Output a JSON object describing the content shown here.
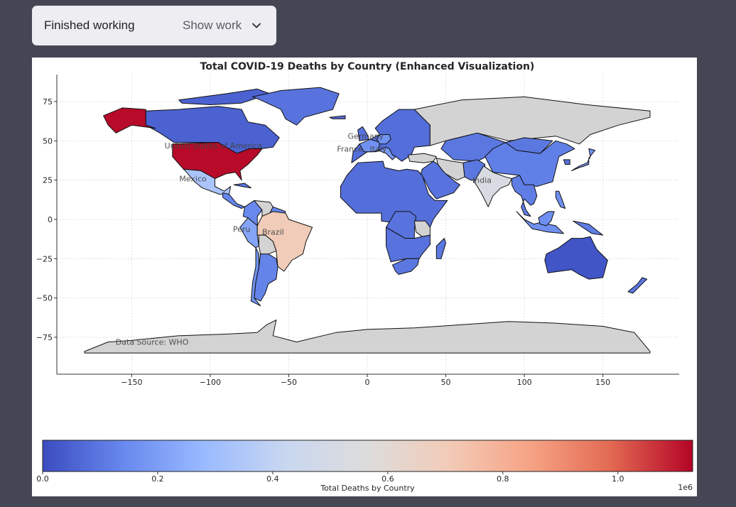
{
  "status": {
    "label": "Finished working",
    "show_work_label": "Show work",
    "chevron_icon": "chevron-down-icon"
  },
  "chart_data": {
    "type": "choropleth",
    "title": "Total COVID-19 Deaths by Country (Enhanced Visualization)",
    "xlabel": "",
    "ylabel": "",
    "xlim": [
      -200,
      196
    ],
    "ylim": [
      -98,
      93
    ],
    "x_ticks": [
      -150,
      -100,
      -50,
      0,
      50,
      100,
      150
    ],
    "x_tick_labels": [
      "−150",
      "−100",
      "−50",
      "0",
      "50",
      "100",
      "150"
    ],
    "y_ticks": [
      75,
      50,
      25,
      0,
      -25,
      -50,
      -75
    ],
    "y_tick_labels": [
      "75",
      "50",
      "25",
      "0",
      "−25",
      "−50",
      "−75"
    ],
    "grid": true,
    "colormap": "coolwarm",
    "missing_color": "#d3d3d3",
    "colorbar": {
      "label": "Total Deaths by Country",
      "range": [
        0,
        1130000
      ],
      "ticks": [
        0,
        0.2,
        0.4,
        0.6,
        0.8,
        1.0
      ],
      "tick_labels": [
        "0.0",
        "0.2",
        "0.4",
        "0.6",
        "0.8",
        "1.0"
      ],
      "offset_label": "1e6",
      "orientation": "horizontal",
      "placement": "bottom",
      "gradient_stops": [
        "#3b4cc0",
        "#6889ee",
        "#9abbff",
        "#c9d7f0",
        "#dddcdc",
        "#f2cbb7",
        "#f6a385",
        "#e26952",
        "#b40426"
      ]
    },
    "annotations": [
      {
        "text": "United States of America",
        "lon": -98,
        "lat": 47
      },
      {
        "text": "Mexico",
        "lon": -111,
        "lat": 26
      },
      {
        "text": "Brazil",
        "lon": -60,
        "lat": -8
      },
      {
        "text": "Peru",
        "lon": -80,
        "lat": -6
      },
      {
        "text": "Germany",
        "lon": -1,
        "lat": 53
      },
      {
        "text": "France",
        "lon": -11,
        "lat": 45
      },
      {
        "text": "Italy",
        "lon": 7,
        "lat": 45
      },
      {
        "text": "India",
        "lon": 73,
        "lat": 25
      },
      {
        "text": "Data Source: WHO",
        "lon": -137,
        "lat": -78
      }
    ],
    "countries": [
      {
        "name": "United States of America",
        "deaths": 1120000
      },
      {
        "name": "Brazil",
        "deaths": 700000
      },
      {
        "name": "India",
        "deaths": 530000
      },
      {
        "name": "Mexico",
        "deaths": 333000
      },
      {
        "name": "Peru",
        "deaths": 220000
      },
      {
        "name": "Germany",
        "deaths": 170000
      },
      {
        "name": "France",
        "deaths": 165000
      },
      {
        "name": "Italy",
        "deaths": 190000
      },
      {
        "name": "China",
        "deaths": 120000
      },
      {
        "name": "Indonesia",
        "deaths": 160000
      },
      {
        "name": "Canada",
        "deaths": 50000
      },
      {
        "name": "Argentina",
        "deaths": 130000
      },
      {
        "name": "Colombia",
        "deaths": 140000
      },
      {
        "name": "South Africa",
        "deaths": 102000
      },
      {
        "name": "Australia",
        "deaths": 20000
      },
      {
        "name": "Russia",
        "deaths": null
      },
      {
        "name": "Iran",
        "deaths": null
      },
      {
        "name": "Turkey",
        "deaths": null
      },
      {
        "name": "Bolivia",
        "deaths": null
      },
      {
        "name": "Venezuela",
        "deaths": null
      },
      {
        "name": "Dem. Rep. Congo",
        "deaths": null
      },
      {
        "name": "Tanzania",
        "deaths": null
      },
      {
        "name": "Antarctica",
        "deaths": null
      }
    ]
  }
}
